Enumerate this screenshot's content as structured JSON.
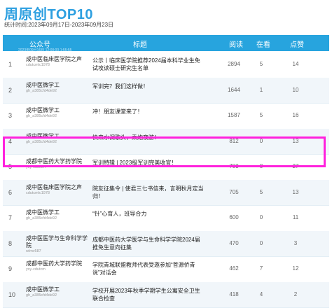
{
  "header": {
    "title": "周原创TOP10",
    "period": "统计时间:2023年09月17日-2023年09月23日"
  },
  "table": {
    "columns": [
      "公众号",
      "标题",
      "阅读",
      "在看",
      "点赞"
    ],
    "sub_text": "2023年09月16日 12:00:00-1:55:55",
    "rows": [
      {
        "rank": "1",
        "account": "成中医临床医学院之声",
        "account_id": "cdutcmlc1978",
        "title": "公示丨临床医学院推荐2024届本科毕业生免试攻读硕士研究生名单",
        "read": "2894",
        "look": "5",
        "like": "14"
      },
      {
        "rank": "2",
        "account": "成中医微学工",
        "account_id": "gh_a385cfd4de92",
        "title": "军训完？我们这样做！",
        "read": "1644",
        "look": "1",
        "like": "10"
      },
      {
        "rank": "3",
        "account": "成中医微学工",
        "account_id": "gh_a385cfd4de92",
        "title": "冲！朋友课堂来了！",
        "read": "1587",
        "look": "5",
        "like": "16"
      },
      {
        "rank": "4",
        "account": "成中医微学工",
        "account_id": "gh_a385cfd4de92",
        "title": "快来水调歌头，乘炮夜游！",
        "read": "812",
        "look": "0",
        "like": "13"
      },
      {
        "rank": "5",
        "account": "成都中医药大学药学院",
        "account_id": "yxy-cdutcm",
        "title": "军训特辑 | 2023级军训完美收官！",
        "read": "783",
        "look": "8",
        "like": "27"
      },
      {
        "rank": "6",
        "account": "成中医临床医学院之声",
        "account_id": "cdutcmlc1978",
        "title": "院友征集令 | 使君三七书信来，言明秋月定当归！",
        "read": "705",
        "look": "5",
        "like": "13"
      },
      {
        "rank": "7",
        "account": "成中医微学工",
        "account_id": "gh_a385cfd4de92",
        "title": "“针”心育人，班导合力",
        "read": "600",
        "look": "0",
        "like": "11"
      },
      {
        "rank": "8",
        "account": "成中医医学与生命科学学院",
        "account_id": "wlmv587",
        "title": "成都中医药大学医学与生命科学学院2024届推免生意向征集",
        "read": "470",
        "look": "0",
        "like": "3"
      },
      {
        "rank": "9",
        "account": "成都中医药大学药学院",
        "account_id": "yxy-cdutcm",
        "title": "学院青城联盟教师代表受邀参加“菩源侨青说”对话会",
        "read": "462",
        "look": "7",
        "like": "12"
      },
      {
        "rank": "10",
        "account": "成中医微学工",
        "account_id": "gh_a385cfd4de92",
        "title": "学校开展2023年秋季学期学生公寓安全卫生联合检查",
        "read": "418",
        "look": "4",
        "like": "2"
      }
    ]
  },
  "colors": {
    "accent": "#27a4de",
    "highlight": "#ff22dd"
  }
}
